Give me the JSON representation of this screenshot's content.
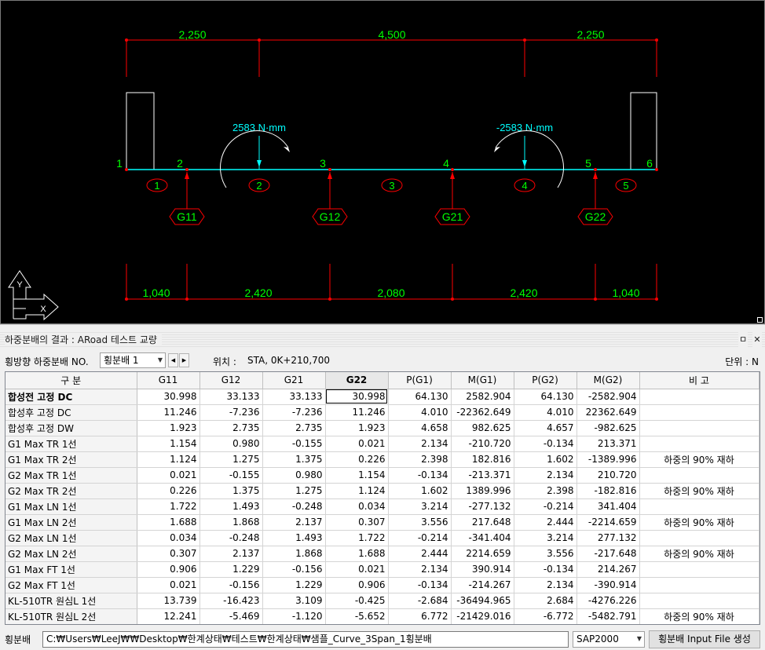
{
  "cad": {
    "top_dims": [
      "2,250",
      "4,500",
      "2,250"
    ],
    "moment_left": "2583 N·mm",
    "moment_right": "-2583 N·mm",
    "nodes": [
      "1",
      "2",
      "3",
      "4",
      "5",
      "6"
    ],
    "elements": [
      "1",
      "2",
      "3",
      "4",
      "5"
    ],
    "girders": [
      "G11",
      "G12",
      "G21",
      "G22"
    ],
    "bottom_dims": [
      "1,040",
      "2,420",
      "2,080",
      "2,420",
      "1,040"
    ],
    "ucs_labels": [
      "Y",
      "X"
    ],
    "colors": {
      "background": "#000000",
      "dimension_line": "#ff0000",
      "dimension_text": "#00ff00",
      "moment": "#00ffff",
      "deck": "#00ffff",
      "structure": "#ffffff"
    }
  },
  "panel": {
    "title": "하중분배의 결과 : ARoad 테스트 교량",
    "pin_icon": "ㅁ",
    "close_icon": "✕",
    "dist_label": "횡방향 하중분배 NO.",
    "dist_select": "횡분배  1",
    "location_label": "위치 :",
    "location_value": "STA, 0K+210,700",
    "unit_label": "단위 : N"
  },
  "grid": {
    "headers": [
      "구 분",
      "G11",
      "G12",
      "G21",
      "G22",
      "P(G1)",
      "M(G1)",
      "P(G2)",
      "M(G2)",
      "비  고"
    ],
    "rows": [
      [
        "합성전 고정 DC",
        "30.998",
        "33.133",
        "33.133",
        "30.998",
        "64.130",
        "2582.904",
        "64.130",
        "-2582.904",
        ""
      ],
      [
        "합성후 고정 DC",
        "11.246",
        "-7.236",
        "-7.236",
        "11.246",
        "4.010",
        "-22362.649",
        "4.010",
        "22362.649",
        ""
      ],
      [
        "합성후 고정 DW",
        "1.923",
        "2.735",
        "2.735",
        "1.923",
        "4.658",
        "982.625",
        "4.657",
        "-982.625",
        ""
      ],
      [
        "G1 Max TR 1선",
        "1.154",
        "0.980",
        "-0.155",
        "0.021",
        "2.134",
        "-210.720",
        "-0.134",
        "213.371",
        ""
      ],
      [
        "G1 Max TR 2선",
        "1.124",
        "1.275",
        "1.375",
        "0.226",
        "2.398",
        "182.816",
        "1.602",
        "-1389.996",
        "하중의 90% 재하"
      ],
      [
        "G2 Max TR 1선",
        "0.021",
        "-0.155",
        "0.980",
        "1.154",
        "-0.134",
        "-213.371",
        "2.134",
        "210.720",
        ""
      ],
      [
        "G2 Max TR 2선",
        "0.226",
        "1.375",
        "1.275",
        "1.124",
        "1.602",
        "1389.996",
        "2.398",
        "-182.816",
        "하중의 90% 재하"
      ],
      [
        "G1 Max LN 1선",
        "1.722",
        "1.493",
        "-0.248",
        "0.034",
        "3.214",
        "-277.132",
        "-0.214",
        "341.404",
        ""
      ],
      [
        "G1 Max LN 2선",
        "1.688",
        "1.868",
        "2.137",
        "0.307",
        "3.556",
        "217.648",
        "2.444",
        "-2214.659",
        "하중의 90% 재하"
      ],
      [
        "G2 Max LN 1선",
        "0.034",
        "-0.248",
        "1.493",
        "1.722",
        "-0.214",
        "-341.404",
        "3.214",
        "277.132",
        ""
      ],
      [
        "G2 Max LN 2선",
        "0.307",
        "2.137",
        "1.868",
        "1.688",
        "2.444",
        "2214.659",
        "3.556",
        "-217.648",
        "하중의 90% 재하"
      ],
      [
        "G1 Max FT 1선",
        "0.906",
        "1.229",
        "-0.156",
        "0.021",
        "2.134",
        "390.914",
        "-0.134",
        "214.267",
        ""
      ],
      [
        "G2 Max FT 1선",
        "0.021",
        "-0.156",
        "1.229",
        "0.906",
        "-0.134",
        "-214.267",
        "2.134",
        "-390.914",
        ""
      ],
      [
        "KL-510TR 원심L 1선",
        "13.739",
        "-16.423",
        "3.109",
        "-0.425",
        "-2.684",
        "-36494.965",
        "2.684",
        "-4276.226",
        ""
      ],
      [
        "KL-510TR 원심L 2선",
        "12.241",
        "-5.469",
        "-1.120",
        "-5.652",
        "6.772",
        "-21429.016",
        "-6.772",
        "-5482.791",
        "하중의 90% 재하"
      ]
    ]
  },
  "bottom": {
    "label": "횡분배",
    "path": "C:₩Users₩LeeJ₩₩Desktop₩한계상태₩테스트₩한계상태₩샘플_Curve_3Span_1횡분배",
    "program": "SAP2000",
    "generate_button": "횡분배 Input File 생성"
  }
}
